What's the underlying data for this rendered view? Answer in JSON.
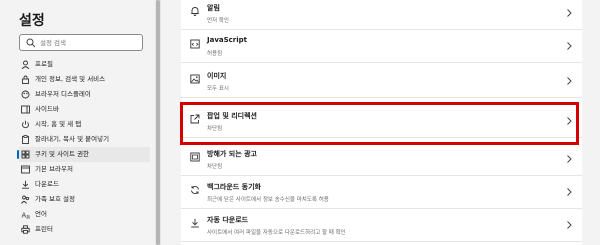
{
  "sidebar": {
    "title": "설정",
    "search_placeholder": "설정 검색",
    "items": [
      {
        "label": "프로필",
        "icon": "profile-icon"
      },
      {
        "label": "개인 정보, 검색 및 서비스",
        "icon": "lock-icon"
      },
      {
        "label": "브라우저 디스플레이",
        "icon": "appearance-icon"
      },
      {
        "label": "사이드바",
        "icon": "sidebar-icon"
      },
      {
        "label": "시작, 홈 및 새 탭",
        "icon": "power-icon"
      },
      {
        "label": "잘라내기, 복사 및 붙여넣기",
        "icon": "clipboard-icon"
      },
      {
        "label": "쿠키 및 사이트 권한",
        "icon": "cookies-icon",
        "active": true
      },
      {
        "label": "기본 브라우저",
        "icon": "browser-icon"
      },
      {
        "label": "다운로드",
        "icon": "download-icon"
      },
      {
        "label": "가족 보호 설정",
        "icon": "family-icon"
      },
      {
        "label": "언어",
        "icon": "language-icon"
      },
      {
        "label": "프린터",
        "icon": "printer-icon"
      }
    ]
  },
  "permissions": [
    {
      "title": "알림",
      "subtitle": "먼저 확인",
      "icon": "bell-icon"
    },
    {
      "title": "JavaScript",
      "subtitle": "허용됨",
      "icon": "code-icon"
    },
    {
      "title": "이미지",
      "subtitle": "모두 표시",
      "icon": "image-icon"
    },
    {
      "title": "팝업 및 리디렉션",
      "subtitle": "차단됨",
      "icon": "popup-icon"
    },
    {
      "title": "방해가 되는 광고",
      "subtitle": "차단됨",
      "icon": "ads-icon"
    },
    {
      "title": "백그라운드 동기화",
      "subtitle": "최근에 닫은 사이트에서 정보 송수신을 마치도록 허용",
      "icon": "sync-icon"
    },
    {
      "title": "자동 다운로드",
      "subtitle": "사이트에서 여러 파일을 자동으로 다운로드하려고 할 때 확인",
      "icon": "download-icon"
    }
  ],
  "colors": {
    "highlight": "#d50000",
    "accent": "#0067c0"
  }
}
